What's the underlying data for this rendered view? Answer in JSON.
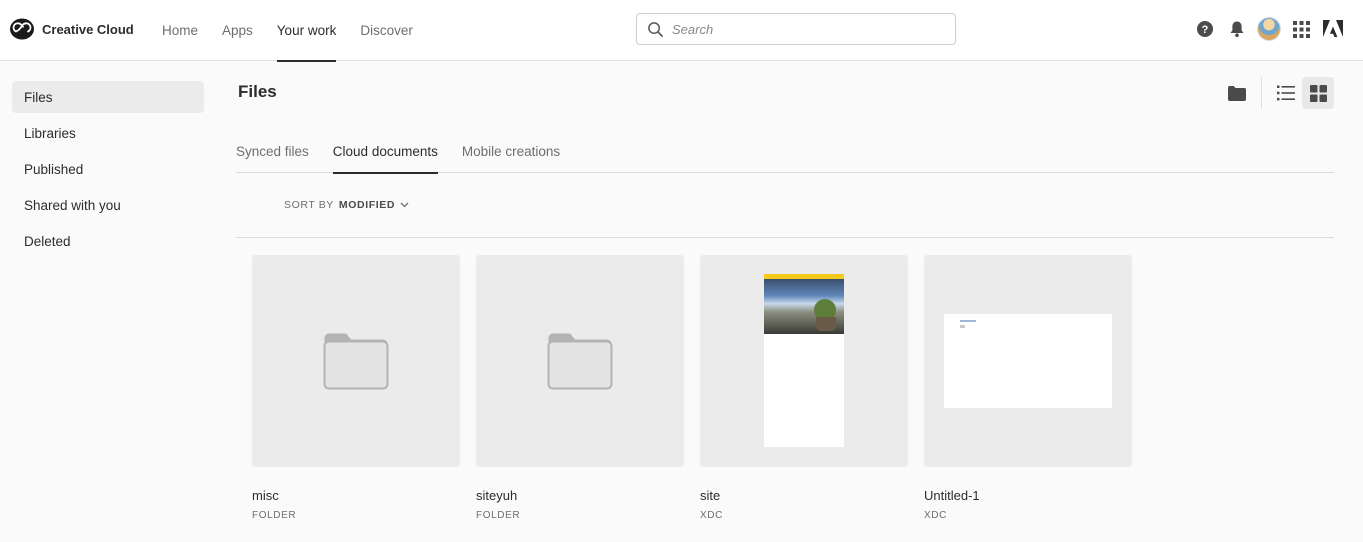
{
  "brand": {
    "name": "Creative Cloud",
    "icon": "creative-cloud-logo-icon"
  },
  "nav": {
    "items": [
      {
        "label": "Home",
        "active": false
      },
      {
        "label": "Apps",
        "active": false
      },
      {
        "label": "Your work",
        "active": true
      },
      {
        "label": "Discover",
        "active": false
      }
    ]
  },
  "search": {
    "placeholder": "Search",
    "value": ""
  },
  "top_icons": [
    "help-icon",
    "bell-icon",
    "avatar",
    "app-grid-icon",
    "adobe-logo-icon"
  ],
  "sidebar": {
    "items": [
      {
        "label": "Files",
        "active": true
      },
      {
        "label": "Libraries",
        "active": false
      },
      {
        "label": "Published",
        "active": false
      },
      {
        "label": "Shared with you",
        "active": false
      },
      {
        "label": "Deleted",
        "active": false
      }
    ]
  },
  "main": {
    "title": "Files",
    "view_toggles": [
      "folder-icon",
      "list-view-icon",
      "grid-view-icon"
    ],
    "active_view": "grid",
    "tabs": [
      {
        "label": "Synced files",
        "active": false
      },
      {
        "label": "Cloud documents",
        "active": true
      },
      {
        "label": "Mobile creations",
        "active": false
      }
    ],
    "sort": {
      "label": "SORT BY",
      "value": "MODIFIED"
    },
    "files": [
      {
        "name": "misc",
        "type": "FOLDER",
        "thumb": "folder"
      },
      {
        "name": "siteyuh",
        "type": "FOLDER",
        "thumb": "folder"
      },
      {
        "name": "site",
        "type": "XDC",
        "thumb": "xd-tall"
      },
      {
        "name": "Untitled-1",
        "type": "XDC",
        "thumb": "xd-wide"
      }
    ]
  },
  "colors": {
    "accent": "#2c2c2c",
    "background": "#fafafa",
    "tile": "#ebebeb",
    "thumb_yellow": "#f4cb1a"
  }
}
